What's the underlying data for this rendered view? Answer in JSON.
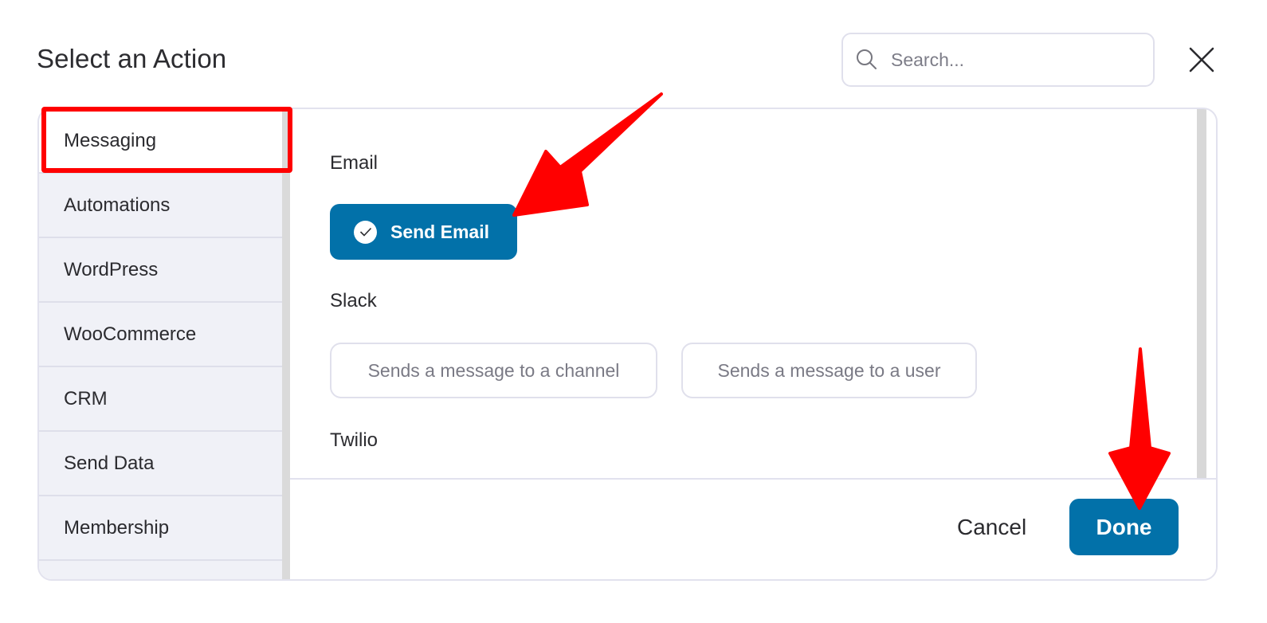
{
  "dialog": {
    "title": "Select an Action",
    "close_icon": "close-x-icon"
  },
  "search": {
    "placeholder": "Search...",
    "value": "",
    "icon": "search-icon"
  },
  "sidebar": {
    "items": [
      {
        "label": "Messaging",
        "active": true
      },
      {
        "label": "Automations",
        "active": false
      },
      {
        "label": "WordPress",
        "active": false
      },
      {
        "label": "WooCommerce",
        "active": false
      },
      {
        "label": "CRM",
        "active": false
      },
      {
        "label": "Send Data",
        "active": false
      },
      {
        "label": "Membership",
        "active": false
      }
    ]
  },
  "content": {
    "groups": [
      {
        "label": "Email",
        "actions": [
          {
            "label": "Send Email",
            "selected": true,
            "icon": "check-circle-icon"
          }
        ]
      },
      {
        "label": "Slack",
        "actions": [
          {
            "label": "Sends a message to a channel",
            "selected": false
          },
          {
            "label": "Sends a message to a user",
            "selected": false
          }
        ]
      },
      {
        "label": "Twilio",
        "actions": []
      }
    ]
  },
  "footer": {
    "cancel_label": "Cancel",
    "done_label": "Done"
  },
  "colors": {
    "primary": "#0271a9",
    "annotation": "#ff0000",
    "sidebar_bg": "#f0f1f7",
    "border": "#e2e2ee"
  }
}
